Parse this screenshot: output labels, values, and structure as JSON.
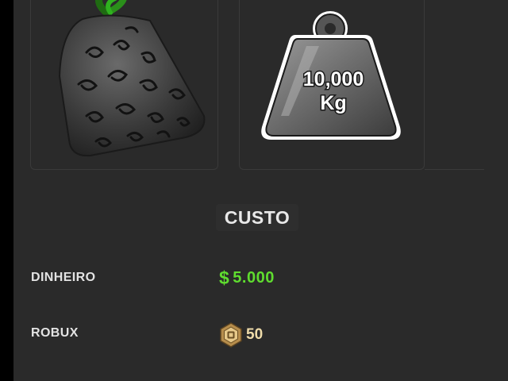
{
  "items": {
    "fruit": {
      "name": "fruit-icon"
    },
    "weight": {
      "name": "weight-icon",
      "value_text": "10,000",
      "unit_text": "Kg"
    }
  },
  "cost": {
    "heading": "CUSTO",
    "cash": {
      "label": "DINHEIRO",
      "currency_symbol": "$",
      "value": "5.000",
      "color": "#5fdc2f"
    },
    "robux": {
      "label": "ROBUX",
      "icon": "robux-icon",
      "value": "50",
      "color": "#efdcaa"
    }
  },
  "colors": {
    "panel": "#2a2a2a",
    "border": "#3a3a3a",
    "text": "#e3e3e3"
  }
}
